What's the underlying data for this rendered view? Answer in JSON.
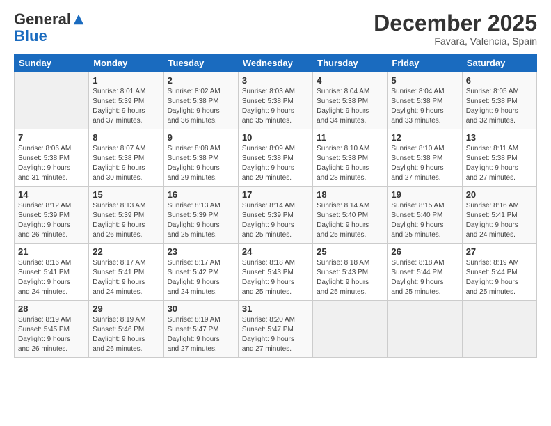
{
  "header": {
    "logo_general": "General",
    "logo_blue": "Blue",
    "month": "December 2025",
    "location": "Favara, Valencia, Spain"
  },
  "days_of_week": [
    "Sunday",
    "Monday",
    "Tuesday",
    "Wednesday",
    "Thursday",
    "Friday",
    "Saturday"
  ],
  "weeks": [
    [
      {
        "day": "",
        "info": ""
      },
      {
        "day": "1",
        "info": "Sunrise: 8:01 AM\nSunset: 5:39 PM\nDaylight: 9 hours\nand 37 minutes."
      },
      {
        "day": "2",
        "info": "Sunrise: 8:02 AM\nSunset: 5:38 PM\nDaylight: 9 hours\nand 36 minutes."
      },
      {
        "day": "3",
        "info": "Sunrise: 8:03 AM\nSunset: 5:38 PM\nDaylight: 9 hours\nand 35 minutes."
      },
      {
        "day": "4",
        "info": "Sunrise: 8:04 AM\nSunset: 5:38 PM\nDaylight: 9 hours\nand 34 minutes."
      },
      {
        "day": "5",
        "info": "Sunrise: 8:04 AM\nSunset: 5:38 PM\nDaylight: 9 hours\nand 33 minutes."
      },
      {
        "day": "6",
        "info": "Sunrise: 8:05 AM\nSunset: 5:38 PM\nDaylight: 9 hours\nand 32 minutes."
      }
    ],
    [
      {
        "day": "7",
        "info": "Sunrise: 8:06 AM\nSunset: 5:38 PM\nDaylight: 9 hours\nand 31 minutes."
      },
      {
        "day": "8",
        "info": "Sunrise: 8:07 AM\nSunset: 5:38 PM\nDaylight: 9 hours\nand 30 minutes."
      },
      {
        "day": "9",
        "info": "Sunrise: 8:08 AM\nSunset: 5:38 PM\nDaylight: 9 hours\nand 29 minutes."
      },
      {
        "day": "10",
        "info": "Sunrise: 8:09 AM\nSunset: 5:38 PM\nDaylight: 9 hours\nand 29 minutes."
      },
      {
        "day": "11",
        "info": "Sunrise: 8:10 AM\nSunset: 5:38 PM\nDaylight: 9 hours\nand 28 minutes."
      },
      {
        "day": "12",
        "info": "Sunrise: 8:10 AM\nSunset: 5:38 PM\nDaylight: 9 hours\nand 27 minutes."
      },
      {
        "day": "13",
        "info": "Sunrise: 8:11 AM\nSunset: 5:38 PM\nDaylight: 9 hours\nand 27 minutes."
      }
    ],
    [
      {
        "day": "14",
        "info": "Sunrise: 8:12 AM\nSunset: 5:39 PM\nDaylight: 9 hours\nand 26 minutes."
      },
      {
        "day": "15",
        "info": "Sunrise: 8:13 AM\nSunset: 5:39 PM\nDaylight: 9 hours\nand 26 minutes."
      },
      {
        "day": "16",
        "info": "Sunrise: 8:13 AM\nSunset: 5:39 PM\nDaylight: 9 hours\nand 25 minutes."
      },
      {
        "day": "17",
        "info": "Sunrise: 8:14 AM\nSunset: 5:39 PM\nDaylight: 9 hours\nand 25 minutes."
      },
      {
        "day": "18",
        "info": "Sunrise: 8:14 AM\nSunset: 5:40 PM\nDaylight: 9 hours\nand 25 minutes."
      },
      {
        "day": "19",
        "info": "Sunrise: 8:15 AM\nSunset: 5:40 PM\nDaylight: 9 hours\nand 25 minutes."
      },
      {
        "day": "20",
        "info": "Sunrise: 8:16 AM\nSunset: 5:41 PM\nDaylight: 9 hours\nand 24 minutes."
      }
    ],
    [
      {
        "day": "21",
        "info": "Sunrise: 8:16 AM\nSunset: 5:41 PM\nDaylight: 9 hours\nand 24 minutes."
      },
      {
        "day": "22",
        "info": "Sunrise: 8:17 AM\nSunset: 5:41 PM\nDaylight: 9 hours\nand 24 minutes."
      },
      {
        "day": "23",
        "info": "Sunrise: 8:17 AM\nSunset: 5:42 PM\nDaylight: 9 hours\nand 24 minutes."
      },
      {
        "day": "24",
        "info": "Sunrise: 8:18 AM\nSunset: 5:43 PM\nDaylight: 9 hours\nand 25 minutes."
      },
      {
        "day": "25",
        "info": "Sunrise: 8:18 AM\nSunset: 5:43 PM\nDaylight: 9 hours\nand 25 minutes."
      },
      {
        "day": "26",
        "info": "Sunrise: 8:18 AM\nSunset: 5:44 PM\nDaylight: 9 hours\nand 25 minutes."
      },
      {
        "day": "27",
        "info": "Sunrise: 8:19 AM\nSunset: 5:44 PM\nDaylight: 9 hours\nand 25 minutes."
      }
    ],
    [
      {
        "day": "28",
        "info": "Sunrise: 8:19 AM\nSunset: 5:45 PM\nDaylight: 9 hours\nand 26 minutes."
      },
      {
        "day": "29",
        "info": "Sunrise: 8:19 AM\nSunset: 5:46 PM\nDaylight: 9 hours\nand 26 minutes."
      },
      {
        "day": "30",
        "info": "Sunrise: 8:19 AM\nSunset: 5:47 PM\nDaylight: 9 hours\nand 27 minutes."
      },
      {
        "day": "31",
        "info": "Sunrise: 8:20 AM\nSunset: 5:47 PM\nDaylight: 9 hours\nand 27 minutes."
      },
      {
        "day": "",
        "info": ""
      },
      {
        "day": "",
        "info": ""
      },
      {
        "day": "",
        "info": ""
      }
    ]
  ]
}
